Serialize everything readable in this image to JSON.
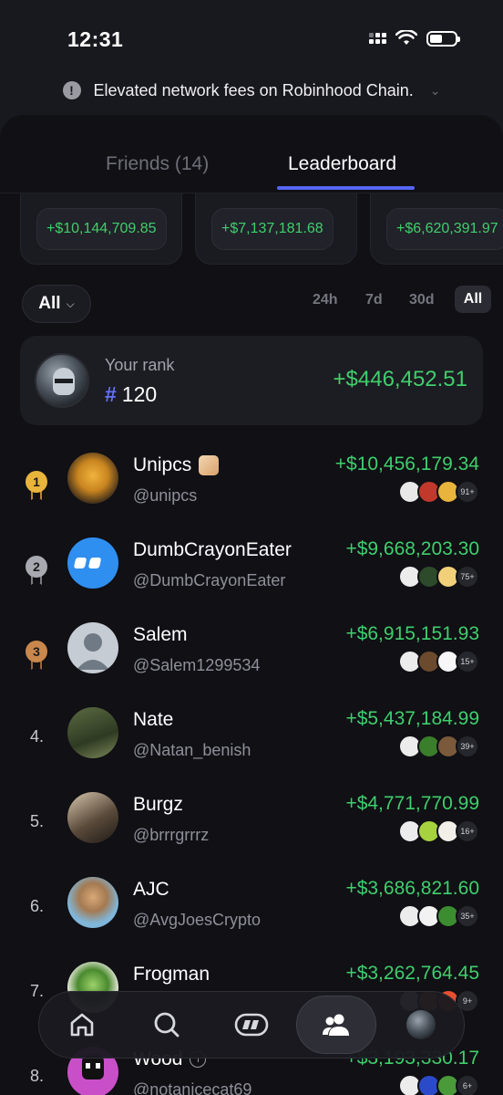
{
  "status_bar": {
    "time": "12:31"
  },
  "notice": {
    "text": "Elevated network fees on Robinhood Chain."
  },
  "tabs": {
    "friends": "Friends (14)",
    "leaderboard": "Leaderboard"
  },
  "top_cards": [
    "+$10,144,709.85",
    "+$7,137,181.68",
    "+$6,620,391.97"
  ],
  "filters": {
    "type_selected": "All",
    "periods": [
      "24h",
      "7d",
      "30d",
      "All"
    ],
    "active_period": "All"
  },
  "your_rank": {
    "label": "Your rank",
    "hash": "#",
    "rank": "120",
    "amount": "+$446,452.51"
  },
  "leaderboard": [
    {
      "rank": "1",
      "medal": "gold",
      "name": "Unipcs",
      "handle": "@unipcs",
      "amount": "+$10,456,179.34",
      "more": "91+"
    },
    {
      "rank": "2",
      "medal": "silver",
      "name": "DumbCrayonEater",
      "handle": "@DumbCrayonEater",
      "amount": "+$9,668,203.30",
      "more": "75+"
    },
    {
      "rank": "3",
      "medal": "bronze",
      "name": "Salem",
      "handle": "@Salem1299534",
      "amount": "+$6,915,151.93",
      "more": "15+"
    },
    {
      "rank": "4.",
      "name": "Nate",
      "handle": "@Natan_benish",
      "amount": "+$5,437,184.99",
      "more": "39+"
    },
    {
      "rank": "5.",
      "name": "Burgz",
      "handle": "@brrrgrrrz",
      "amount": "+$4,771,770.99",
      "more": "16+"
    },
    {
      "rank": "6.",
      "name": "AJC",
      "handle": "@AvgJoesCrypto",
      "amount": "+$3,686,821.60",
      "more": "35+"
    },
    {
      "rank": "7.",
      "name": "Frogman",
      "handle": "",
      "amount": "+$3,262,764.45",
      "more": "9+"
    },
    {
      "rank": "8.",
      "name": "Wood",
      "handle": "@notanicecat69",
      "amount": "+$3,193,330.17",
      "more": "6+"
    }
  ],
  "colors": {
    "accent": "#5765f2",
    "positive": "#3fcf6b",
    "background": "#101015"
  },
  "bottom_nav": {
    "items": [
      "home-icon",
      "search-icon",
      "exchange-icon",
      "friends-icon",
      "profile-avatar"
    ],
    "active": "friends-icon"
  }
}
